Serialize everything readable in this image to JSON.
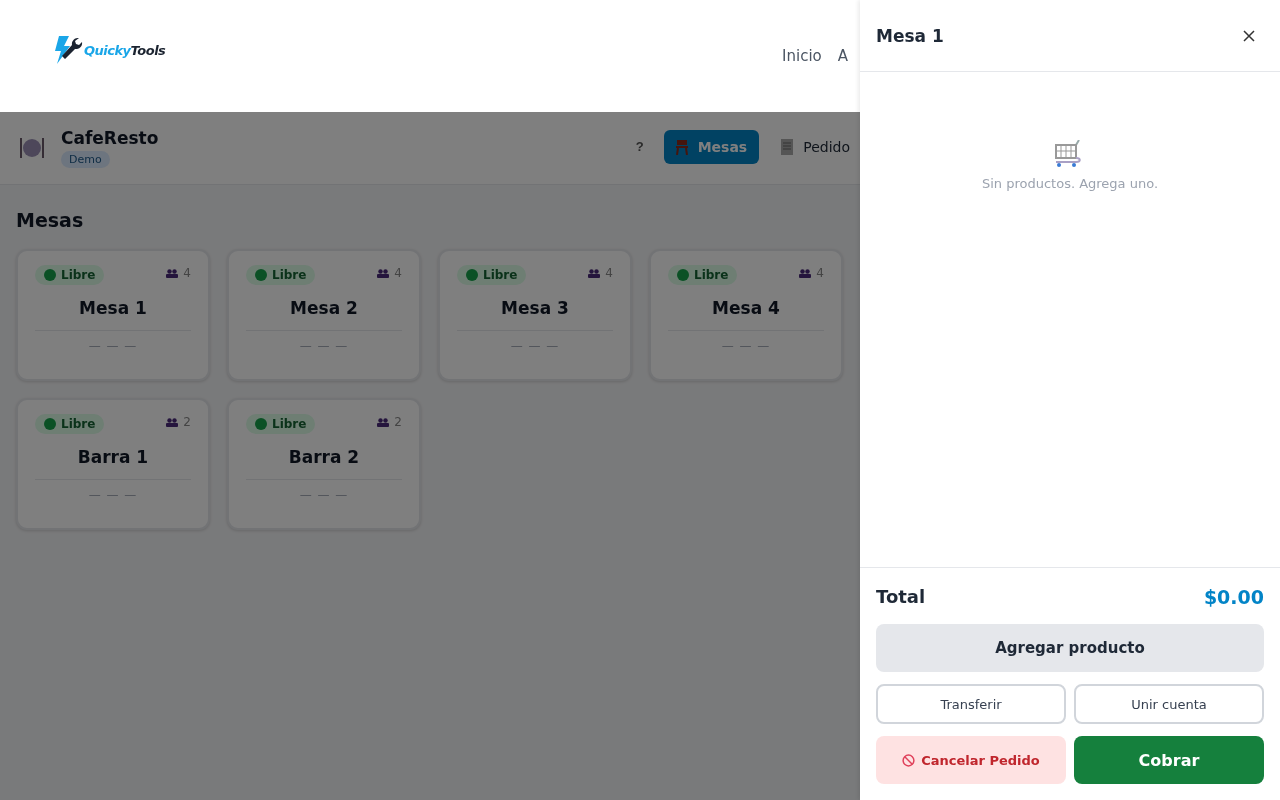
{
  "header": {
    "logo": {
      "part_1": "Quicky",
      "part_2": "Tools"
    },
    "nav": [
      {
        "label": "Inicio"
      },
      {
        "label": "A"
      }
    ]
  },
  "app_bar": {
    "title": "CafeResto",
    "badge": "Demo",
    "help": "?",
    "tabs": [
      {
        "label": "Mesas",
        "selected": true
      },
      {
        "label": "Pedido",
        "selected": false
      }
    ]
  },
  "section_title": "Mesas",
  "tables": [
    {
      "status": "Libre",
      "seats": "4",
      "name": "Mesa 1",
      "summary": "— — —"
    },
    {
      "status": "Libre",
      "seats": "4",
      "name": "Mesa 2",
      "summary": "— — —"
    },
    {
      "status": "Libre",
      "seats": "4",
      "name": "Mesa 3",
      "summary": "— — —"
    },
    {
      "status": "Libre",
      "seats": "4",
      "name": "Mesa 4",
      "summary": "— — —"
    },
    {
      "status": "Libre",
      "seats": "2",
      "name": "Barra 1",
      "summary": "— — —"
    },
    {
      "status": "Libre",
      "seats": "2",
      "name": "Barra 2",
      "summary": "— — —"
    }
  ],
  "drawer": {
    "title": "Mesa 1",
    "empty_text": "Sin productos. Agrega uno.",
    "total_label": "Total",
    "total_value": "$0.00",
    "buttons": [
      {
        "label": "Agregar producto",
        "kind": "secondary"
      },
      {
        "label": "Transferir",
        "kind": "outline"
      },
      {
        "label": "Unir cuenta",
        "kind": "outline"
      },
      {
        "label": "Cancelar Pedido",
        "kind": "danger"
      },
      {
        "label": "Cobrar",
        "kind": "primary"
      }
    ]
  }
}
